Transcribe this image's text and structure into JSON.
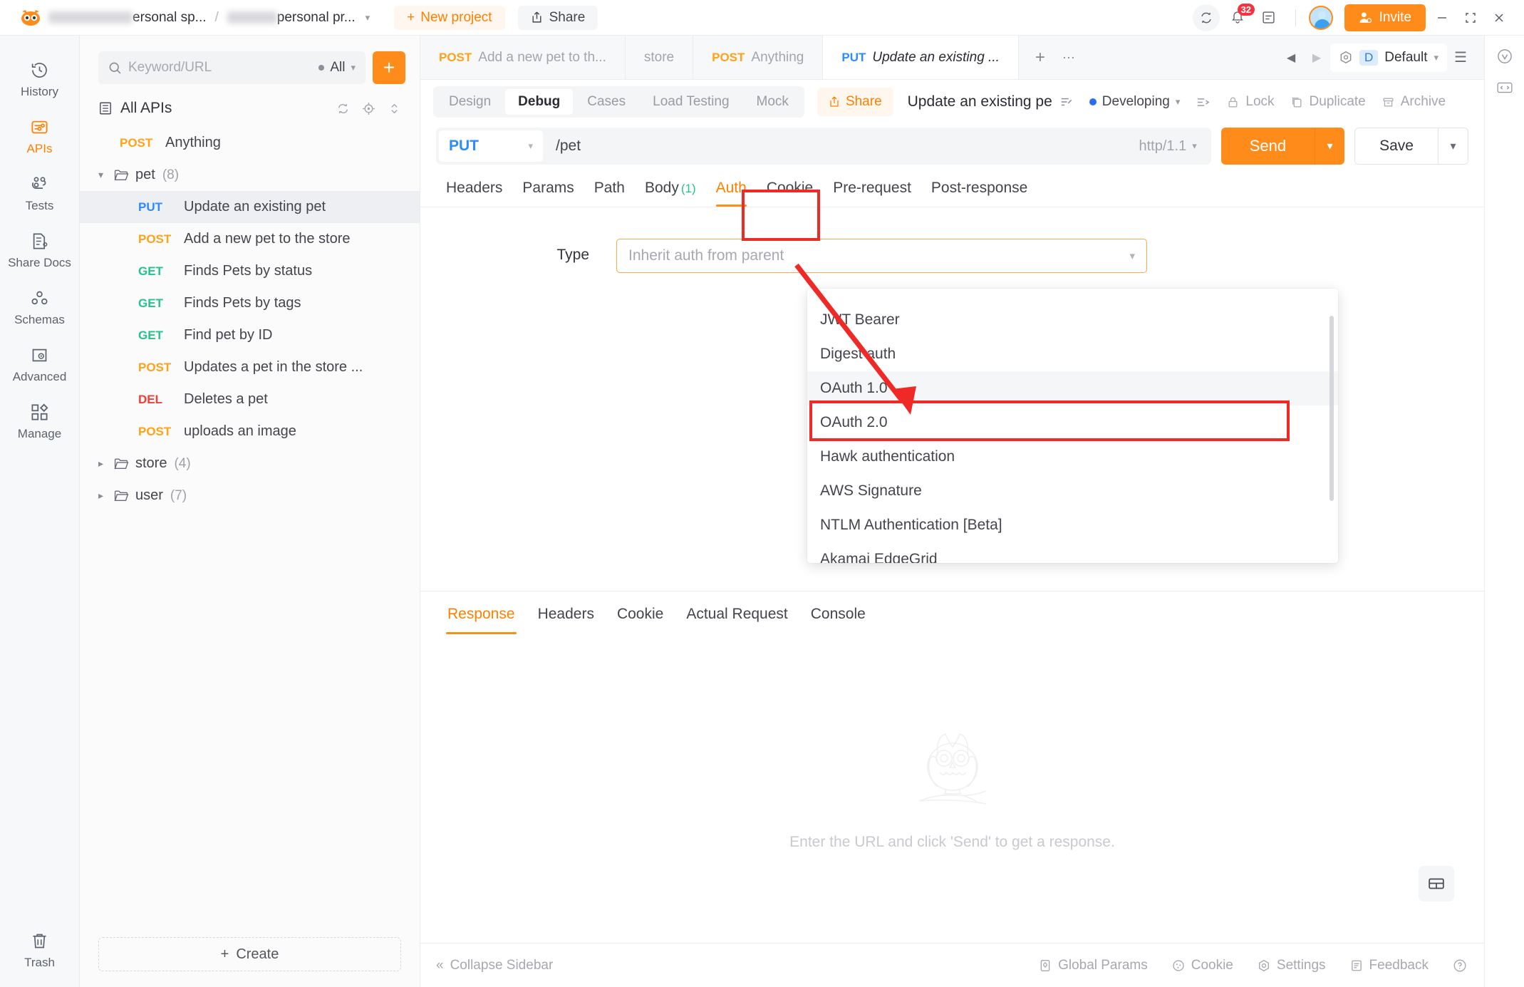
{
  "topbar": {
    "workspace_suffix": "ersonal sp...",
    "separator": "/",
    "project_suffix": "personal pr...",
    "new_project": "New project",
    "share": "Share",
    "notification_count": "32",
    "invite": "Invite"
  },
  "rail": {
    "items": [
      {
        "label": "History",
        "icon": "history-icon",
        "active": false
      },
      {
        "label": "APIs",
        "icon": "apis-icon",
        "active": true
      },
      {
        "label": "Tests",
        "icon": "tests-icon",
        "active": false
      },
      {
        "label": "Share Docs",
        "icon": "share-docs-icon",
        "active": false
      },
      {
        "label": "Schemas",
        "icon": "schemas-icon",
        "active": false
      },
      {
        "label": "Advanced",
        "icon": "advanced-icon",
        "active": false
      },
      {
        "label": "Manage",
        "icon": "manage-icon",
        "active": false
      }
    ],
    "trash": "Trash"
  },
  "tree": {
    "search_placeholder": "Keyword/URL",
    "filter_label": "All",
    "root_label": "All APIs",
    "create_label": "Create",
    "items": [
      {
        "level": 1,
        "method": "POST",
        "label": "Anything",
        "count": "",
        "type": "api",
        "selected": false
      },
      {
        "level": 0,
        "method": "",
        "label": "pet",
        "count": "(8)",
        "type": "folder",
        "expanded": true,
        "selected": false
      },
      {
        "level": 2,
        "method": "PUT",
        "label": "Update an existing pet",
        "count": "",
        "type": "api",
        "selected": true
      },
      {
        "level": 2,
        "method": "POST",
        "label": "Add a new pet to the store",
        "count": "",
        "type": "api",
        "selected": false
      },
      {
        "level": 2,
        "method": "GET",
        "label": "Finds Pets by status",
        "count": "",
        "type": "api",
        "selected": false
      },
      {
        "level": 2,
        "method": "GET",
        "label": "Finds Pets by tags",
        "count": "",
        "type": "api",
        "selected": false
      },
      {
        "level": 2,
        "method": "GET",
        "label": "Find pet by ID",
        "count": "",
        "type": "api",
        "selected": false
      },
      {
        "level": 2,
        "method": "POST",
        "label": "Updates a pet in the store ...",
        "count": "",
        "type": "api",
        "selected": false
      },
      {
        "level": 2,
        "method": "DEL",
        "label": "Deletes a pet",
        "count": "",
        "type": "api",
        "selected": false
      },
      {
        "level": 2,
        "method": "POST",
        "label": "uploads an image",
        "count": "",
        "type": "api",
        "selected": false
      },
      {
        "level": 0,
        "method": "",
        "label": "store",
        "count": "(4)",
        "type": "folder",
        "expanded": false,
        "selected": false
      },
      {
        "level": 0,
        "method": "",
        "label": "user",
        "count": "(7)",
        "type": "folder",
        "expanded": false,
        "selected": false
      }
    ]
  },
  "tabstrip": {
    "tabs": [
      {
        "method": "POST",
        "label": "Add a new pet to th...",
        "active": false
      },
      {
        "method": "",
        "label": "store",
        "active": false
      },
      {
        "method": "POST",
        "label": "Anything",
        "active": false
      },
      {
        "method": "PUT",
        "label": "Update an existing ...",
        "active": true
      }
    ],
    "add": "+",
    "more": "···",
    "env_chip": "D",
    "env_label": "Default"
  },
  "toolbar": {
    "segments": [
      {
        "label": "Design",
        "active": false
      },
      {
        "label": "Debug",
        "active": true
      },
      {
        "label": "Cases",
        "active": false
      },
      {
        "label": "Load Testing",
        "active": false
      },
      {
        "label": "Mock",
        "active": false
      }
    ],
    "share": "Share",
    "api_name": "Update an existing pe",
    "status": "Developing",
    "lock": "Lock",
    "duplicate": "Duplicate",
    "archive": "Archive"
  },
  "url": {
    "method": "PUT",
    "path": "/pet",
    "protocol": "http/1.1",
    "send": "Send",
    "save": "Save"
  },
  "request_tabs": [
    {
      "label": "Headers",
      "badge": "",
      "active": false
    },
    {
      "label": "Params",
      "badge": "",
      "active": false
    },
    {
      "label": "Path",
      "badge": "",
      "active": false
    },
    {
      "label": "Body",
      "badge": "(1)",
      "active": false
    },
    {
      "label": "Auth",
      "badge": "",
      "active": true
    },
    {
      "label": "Cookie",
      "badge": "",
      "active": false
    },
    {
      "label": "Pre-request",
      "badge": "",
      "active": false
    },
    {
      "label": "Post-response",
      "badge": "",
      "active": false
    }
  ],
  "auth": {
    "type_label": "Type",
    "type_placeholder": "Inherit auth from parent",
    "options": [
      {
        "label": "JWT Bearer",
        "hover": false,
        "highlighted": false
      },
      {
        "label": "Digest auth",
        "hover": false,
        "highlighted": false
      },
      {
        "label": "OAuth 1.0",
        "hover": true,
        "highlighted": false
      },
      {
        "label": "OAuth 2.0",
        "hover": false,
        "highlighted": true
      },
      {
        "label": "Hawk authentication",
        "hover": false,
        "highlighted": false
      },
      {
        "label": "AWS Signature",
        "hover": false,
        "highlighted": false
      },
      {
        "label": "NTLM Authentication [Beta]",
        "hover": false,
        "highlighted": false
      },
      {
        "label": "Akamai EdgeGrid",
        "hover": false,
        "highlighted": false
      }
    ]
  },
  "response": {
    "tabs": [
      {
        "label": "Response",
        "active": true
      },
      {
        "label": "Headers",
        "active": false
      },
      {
        "label": "Cookie",
        "active": false
      },
      {
        "label": "Actual Request",
        "active": false
      },
      {
        "label": "Console",
        "active": false
      }
    ],
    "empty_text": "Enter the URL and click 'Send' to get a response."
  },
  "bottom": {
    "collapse": "Collapse Sidebar",
    "global_params": "Global Params",
    "cookie": "Cookie",
    "settings": "Settings",
    "feedback": "Feedback"
  },
  "colors": {
    "accent": "#ff8c1a",
    "annotation": "#ef2a26",
    "put": "#2b8cff",
    "post": "#ffa217",
    "get": "#25c28a",
    "del": "#fa3b32"
  }
}
